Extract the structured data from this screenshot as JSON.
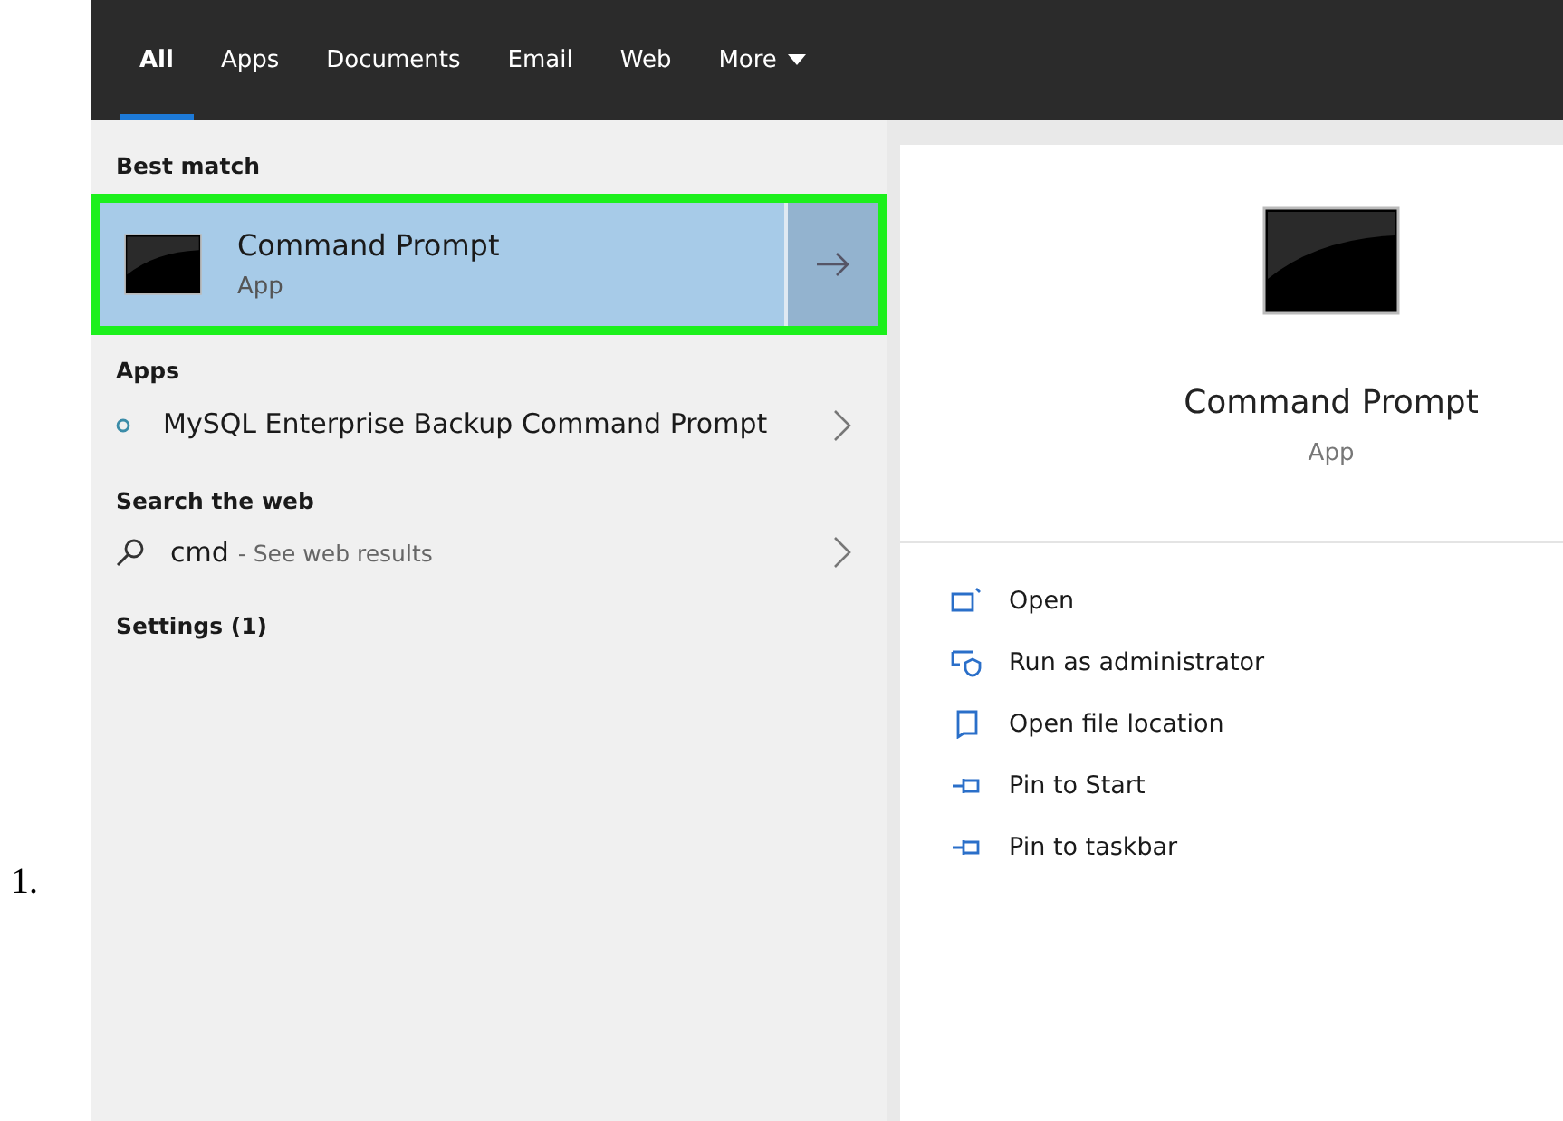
{
  "step_number": "1.",
  "tabs": [
    {
      "label": "All",
      "selected": true,
      "kind": "plain"
    },
    {
      "label": "Apps",
      "selected": false,
      "kind": "plain"
    },
    {
      "label": "Documents",
      "selected": false,
      "kind": "plain"
    },
    {
      "label": "Email",
      "selected": false,
      "kind": "plain"
    },
    {
      "label": "Web",
      "selected": false,
      "kind": "plain"
    },
    {
      "label": "More",
      "selected": false,
      "kind": "dropdown"
    }
  ],
  "sections": [
    {
      "heading": "Best match",
      "items": [
        {
          "kind": "best",
          "title": "Command Prompt",
          "subtitle": "App",
          "selected": true,
          "highlighted": true
        }
      ]
    },
    {
      "heading": "Apps",
      "items": [
        {
          "kind": "app",
          "title": "MySQL Enterprise Backup Command Prompt",
          "selected": false,
          "highlighted": false
        }
      ]
    },
    {
      "heading": "Search the web",
      "items": [
        {
          "kind": "web",
          "title": "cmd",
          "subtitle": "- See web results",
          "selected": false,
          "highlighted": false
        }
      ]
    },
    {
      "heading": "Settings (1)"
    }
  ],
  "details": {
    "title": "Command Prompt",
    "subtitle": "App",
    "actions": [
      {
        "kind": "open",
        "label": "Open"
      },
      {
        "kind": "admin",
        "label": "Run as administrator"
      },
      {
        "kind": "folder",
        "label": "Open file location"
      },
      {
        "kind": "pin",
        "label": "Pin to Start"
      },
      {
        "kind": "pin",
        "label": "Pin to taskbar"
      }
    ]
  }
}
